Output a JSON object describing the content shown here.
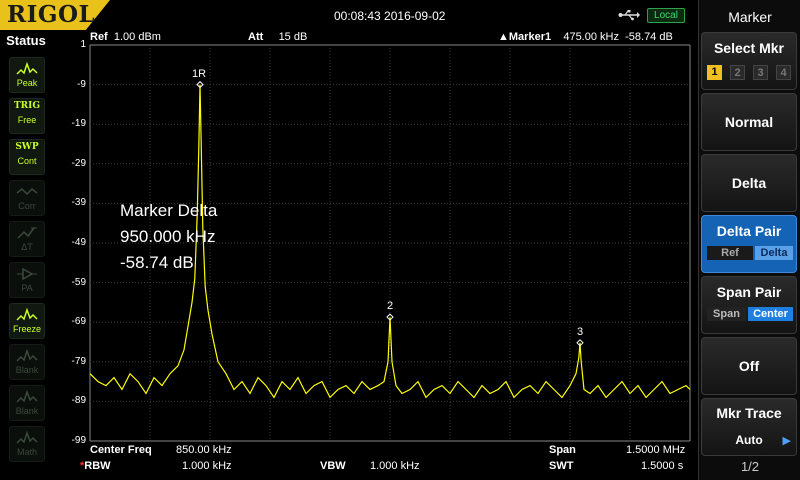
{
  "brand": {
    "logo": "RIGOL"
  },
  "topbar": {
    "datetime": "00:08:43 2016-09-02",
    "local_label": "Local"
  },
  "status": {
    "title": "Status",
    "items": [
      {
        "label": "Peak",
        "icon": "peak-icon",
        "active": true
      },
      {
        "text": "TRIG",
        "label": "Free",
        "active": true
      },
      {
        "text": "SWP",
        "label": "Cont",
        "active": true
      },
      {
        "label": "Corr",
        "icon": "corr-icon",
        "active": false
      },
      {
        "label": "ΔT",
        "icon": "delta-t-icon",
        "active": false
      },
      {
        "label": "PA",
        "icon": "pa-icon",
        "active": false
      },
      {
        "label": "Freeze",
        "icon": "freeze-icon",
        "active": true
      },
      {
        "label": "Blank",
        "icon": "blank-icon",
        "active": false
      },
      {
        "label": "Blank",
        "icon": "blank-icon",
        "active": false
      },
      {
        "label": "Math",
        "icon": "math-icon",
        "active": false
      }
    ]
  },
  "header": {
    "ref_label": "Ref",
    "ref_value": "1.00 dBm",
    "att_label": "Att",
    "att_value": "15 dB",
    "marker_label": "Marker1",
    "marker_freq": "475.00 kHz",
    "marker_amp": "-58.74 dB"
  },
  "y_axis": {
    "labels": [
      "1",
      "-9",
      "-19",
      "-29",
      "-39",
      "-49",
      "-59",
      "-69",
      "-79",
      "-89",
      "-99"
    ]
  },
  "delta_readout": {
    "title": "Marker Delta",
    "freq": "950.000 kHz",
    "amp": "-58.74 dB"
  },
  "markers": [
    {
      "label": "1R",
      "freq_khz": 375,
      "amp_db": -9
    },
    {
      "label": "2",
      "freq_khz": 850,
      "amp_db": -67.7
    },
    {
      "label": "3",
      "freq_khz": 1325,
      "amp_db": -74.2
    }
  ],
  "footer": {
    "center_label": "Center Freq",
    "center_value": "850.00 kHz",
    "span_label": "Span",
    "span_value": "1.5000 MHz",
    "rbw_star": "*",
    "rbw_label": "RBW",
    "rbw_value": "1.000 kHz",
    "vbw_label": "VBW",
    "vbw_value": "1.000 kHz",
    "swt_label": "SWT",
    "swt_value": "1.5000 s"
  },
  "softkeys": {
    "title": "Marker",
    "select_mkr": {
      "label": "Select Mkr",
      "options": [
        "1",
        "2",
        "3",
        "4"
      ],
      "selected": "1"
    },
    "normal": "Normal",
    "delta": "Delta",
    "delta_pair": {
      "label": "Delta Pair",
      "ref": "Ref",
      "delta": "Delta"
    },
    "span_pair": {
      "label": "Span Pair",
      "span": "Span",
      "center": "Center"
    },
    "off": "Off",
    "mkr_trace": {
      "label": "Mkr Trace",
      "value": "Auto"
    },
    "page": "1/2"
  },
  "chart_data": {
    "type": "line",
    "x_range_khz": [
      100,
      1600
    ],
    "ylim": [
      -99,
      1
    ],
    "grid": true,
    "color": "#ffff00",
    "series": [
      {
        "x": [
          100,
          120,
          140,
          160,
          180,
          200,
          220,
          240,
          260,
          280,
          300,
          320,
          335,
          345,
          355,
          362,
          368,
          372,
          375,
          378,
          382,
          388,
          395,
          405,
          420,
          440,
          460,
          480,
          500,
          520,
          540,
          560,
          580,
          600,
          620,
          640,
          660,
          680,
          700,
          720,
          740,
          760,
          780,
          800,
          820,
          835,
          845,
          850,
          855,
          865,
          880,
          900,
          920,
          940,
          960,
          980,
          1000,
          1020,
          1040,
          1060,
          1080,
          1100,
          1120,
          1140,
          1160,
          1180,
          1200,
          1220,
          1240,
          1260,
          1280,
          1300,
          1315,
          1322,
          1325,
          1328,
          1335,
          1350,
          1370,
          1390,
          1410,
          1430,
          1450,
          1470,
          1490,
          1510,
          1530,
          1550,
          1570,
          1590,
          1600
        ],
        "y": [
          -82,
          -84,
          -85,
          -83,
          -86,
          -82,
          -84,
          -87,
          -83,
          -85,
          -82,
          -80,
          -76,
          -70,
          -64,
          -58,
          -42,
          -25,
          -9,
          -24,
          -45,
          -60,
          -66,
          -72,
          -79,
          -82,
          -86,
          -84,
          -87,
          -83,
          -85,
          -88,
          -84,
          -86,
          -83,
          -87,
          -85,
          -84,
          -88,
          -86,
          -85,
          -87,
          -84,
          -86,
          -85,
          -84,
          -79,
          -67.7,
          -79,
          -85,
          -87,
          -86,
          -84,
          -88,
          -86,
          -85,
          -87,
          -84,
          -86,
          -88,
          -85,
          -87,
          -86,
          -84,
          -88,
          -86,
          -85,
          -87,
          -84,
          -86,
          -88,
          -85,
          -82,
          -78,
          -74.2,
          -79,
          -86,
          -87,
          -85,
          -88,
          -86,
          -84,
          -87,
          -85,
          -88,
          -86,
          -84,
          -87,
          -86,
          -85,
          -86
        ]
      }
    ]
  }
}
